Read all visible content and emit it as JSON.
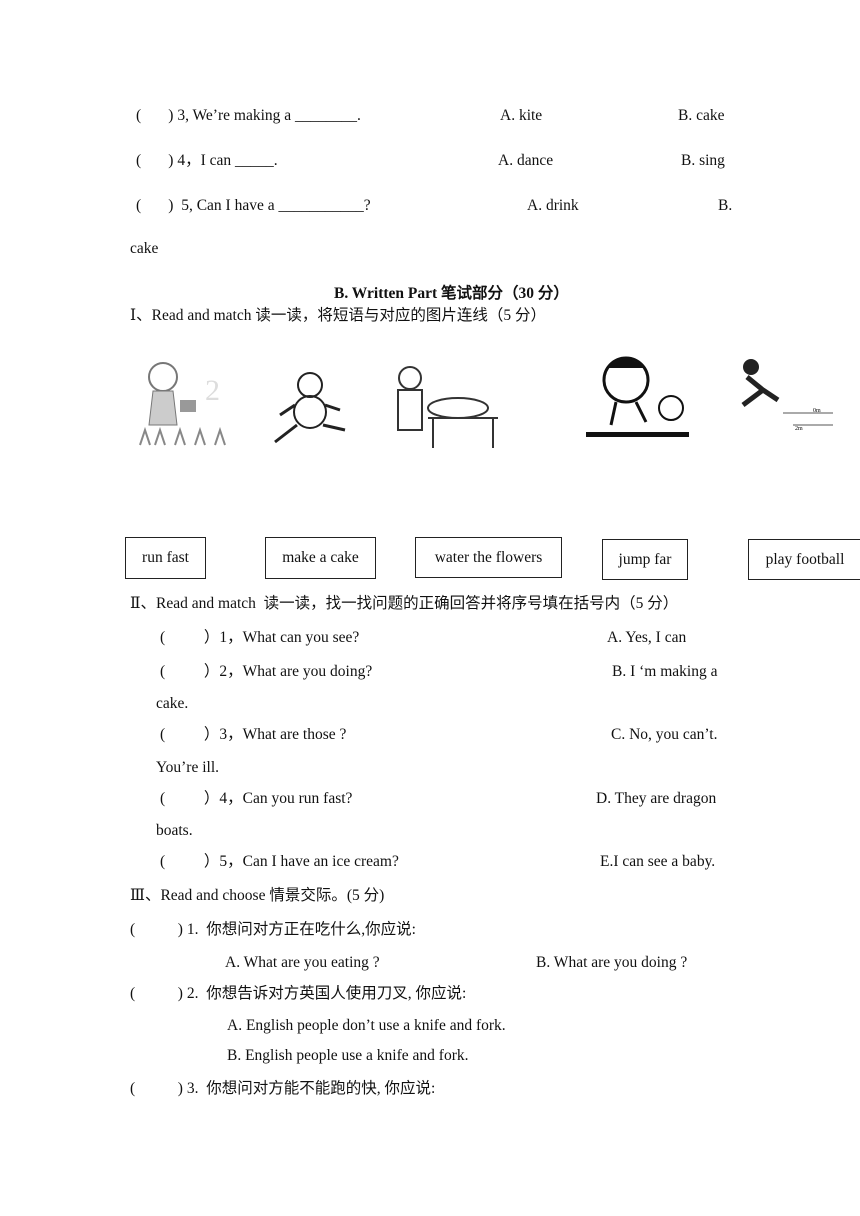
{
  "listening_tail": [
    {
      "q": "(       ) 3, We’re making a ________.",
      "a": "A. kite",
      "b": "B. cake"
    },
    {
      "q": "(       ) 4，I can _____.",
      "a": "A. dance",
      "b": "B. sing"
    },
    {
      "q": "(       )  5, Can I have a ___________?",
      "a": "A. drink",
      "b": "B."
    }
  ],
  "wrap_cake": "cake",
  "section_b_title": "B. Written Part 笔试部分（30 分）",
  "part1": {
    "heading": "Ⅰ、Read and match 读一读，将短语与对应的图片连线（5 分）",
    "images": [
      "girl-watering-flowers",
      "boy-running",
      "chef-making-cake",
      "boy-playing-football",
      "boy-jumping"
    ],
    "phrases": [
      "run fast",
      "make a cake",
      "water the flowers",
      "jump far",
      "play football"
    ]
  },
  "part2": {
    "heading": "Ⅱ、Read and match  读一读，找一找问题的正确回答并将序号填在括号内（5 分）",
    "questions": [
      "(          ）1，What can you see?",
      "(          ）2，What are you doing?",
      "(          ）3，What are those ?",
      "(          ）4，Can you run fast?",
      "(          ）5，Can I have an ice cream?"
    ],
    "answers": [
      "A. Yes, I can",
      "B. I ‘m making a",
      "C. No, you can’t.",
      "D. They are dragon",
      "E.I can see a baby."
    ],
    "wraps": [
      "cake.",
      "You’re ill.",
      "boats."
    ]
  },
  "part3": {
    "heading": "Ⅲ、Read and choose 情景交际。(5 分)",
    "q1": "(           ) 1.  你想问对方正在吃什么,你应说:",
    "q1a": "A. What are you eating ?",
    "q1b": "B. What are you doing ?",
    "q2": "(           ) 2.  你想告诉对方英国人使用刀叉, 你应说:",
    "q2a": "A. English people don’t use a knife and fork.",
    "q2b": "B. English people use a knife and fork.",
    "q3": "(           ) 3.  你想问对方能不能跑的快, 你应说:"
  }
}
